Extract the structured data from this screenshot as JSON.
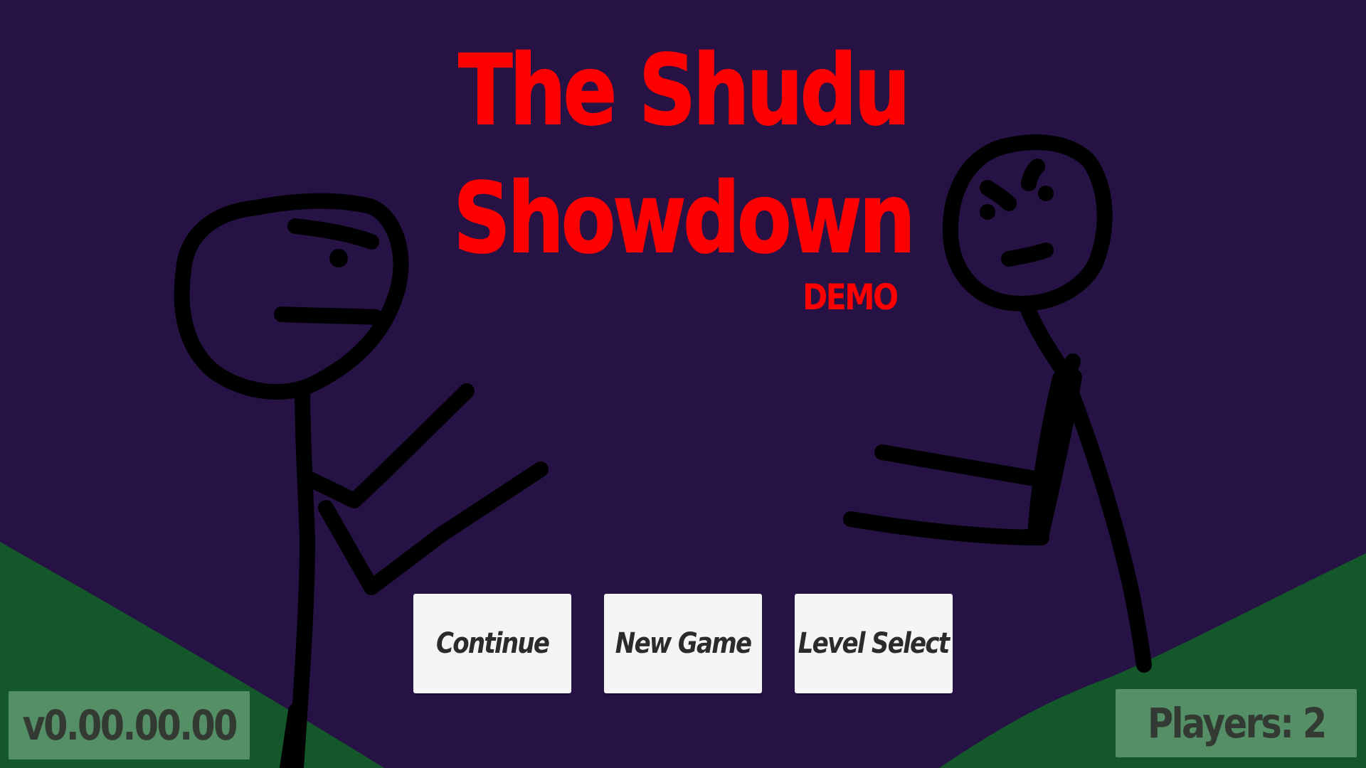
{
  "game": {
    "title_line_1": "The Shudu",
    "title_line_2": "Showdown",
    "edition_tag": "DEMO"
  },
  "menu": {
    "continue_label": "Continue",
    "new_game_label": "New Game",
    "level_select_label": "Level Select"
  },
  "status": {
    "version": "v0.00.00.00",
    "players": "Players: 2"
  },
  "colors": {
    "background": "#261244",
    "hills": "#14572a",
    "title": "#ff0000",
    "button_face": "#f5f5f5",
    "info_panel": "#7fb08a"
  }
}
